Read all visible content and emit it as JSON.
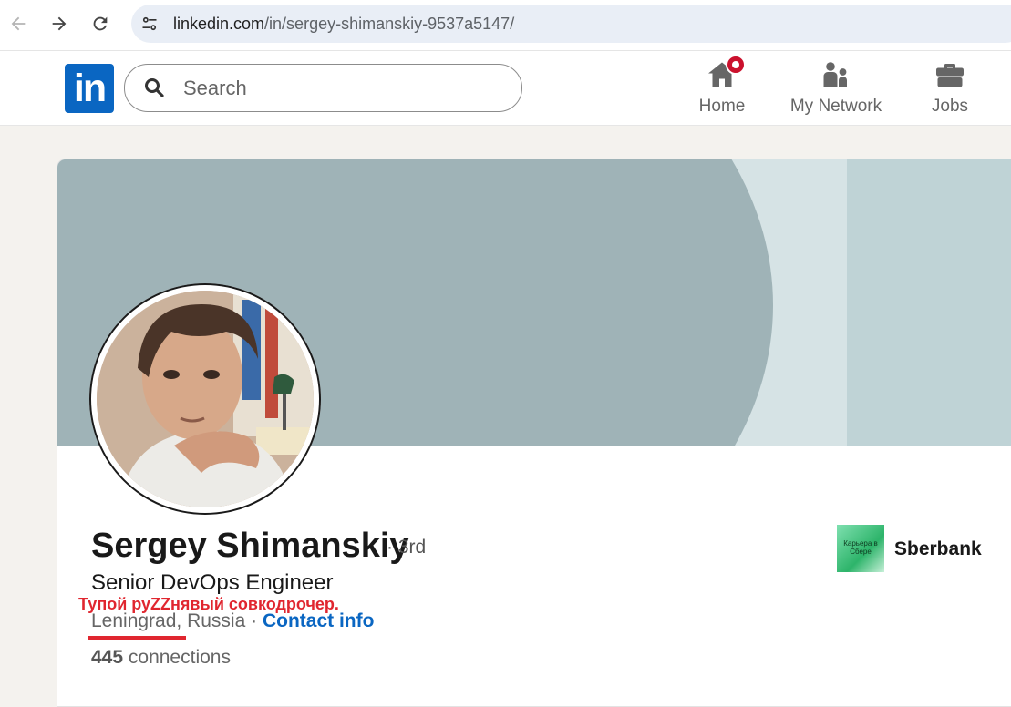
{
  "browser": {
    "url_host": "linkedin.com",
    "url_path": "/in/sergey-shimanskiy-9537a5147/"
  },
  "header": {
    "logo_text": "in",
    "search_placeholder": "Search",
    "nav": [
      {
        "label": "Home",
        "icon": "home-icon"
      },
      {
        "label": "My Network",
        "icon": "people-icon"
      },
      {
        "label": "Jobs",
        "icon": "briefcase-icon"
      }
    ]
  },
  "profile": {
    "name": "Sergey Shimanskiy",
    "degree": "· 3rd",
    "headline": "Senior DevOps Engineer",
    "location": "Leningrad, Russia",
    "separator": "·",
    "contact_label": "Contact info",
    "connections_count": "445",
    "connections_label": "connections",
    "company_name": "Sberbank",
    "company_logo_text": "Карьера в Сбере"
  },
  "overlay": {
    "annotation": "Тупой руZZнявый совкодрочер."
  },
  "colors": {
    "brand": "#0a66c2",
    "notification": "#cb112d",
    "annotation": "#e0262f"
  }
}
